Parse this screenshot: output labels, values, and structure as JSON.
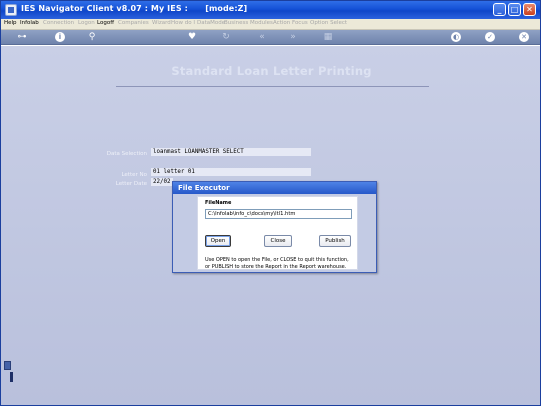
{
  "window": {
    "title": "IES Navigator Client v8.07 : My IES :",
    "mode": "[mode:Z]"
  },
  "menubar": {
    "items": [
      {
        "label": "Help",
        "enabled": true
      },
      {
        "label": "Infolab",
        "enabled": true
      },
      {
        "label": "Connection",
        "enabled": false
      },
      {
        "label": "Logon",
        "enabled": false
      },
      {
        "label": "Logoff",
        "enabled": true
      },
      {
        "label": "Companies",
        "enabled": false
      },
      {
        "label": "Wizard",
        "enabled": false
      },
      {
        "label": "How do I",
        "enabled": false
      },
      {
        "label": "DataMode",
        "enabled": false
      },
      {
        "label": "Business Modules",
        "enabled": false
      },
      {
        "label": "Action Focus",
        "enabled": false
      },
      {
        "label": "Option Select",
        "enabled": false
      }
    ]
  },
  "toolbar": {
    "icons": [
      "key-icon",
      "info-icon",
      "search-icon",
      "heart-icon",
      "refresh-icon",
      "back-icon",
      "forward-icon",
      "grid-icon",
      "globe-icon",
      "check-icon",
      "close-icon"
    ]
  },
  "page": {
    "title": "Standard Loan Letter Printing"
  },
  "fields": {
    "data_selection": {
      "label": "Data Selection",
      "value": "loanmast LOANMASTER SELECT"
    },
    "letter_no": {
      "label": "Letter No",
      "value": "01 letter 01"
    },
    "letter_date": {
      "label": "Letter Date",
      "value": "22/02"
    }
  },
  "dialog": {
    "title": "File Executor",
    "filename_label": "FileName",
    "filename_value": "C:\\Infolab\\info_c\\docs\\my\\ltl1.htm",
    "open_label": "Open",
    "close_label": "Close",
    "publish_label": "Publish",
    "help_text": "Use OPEN to open the File, or CLOSE to quit this function, or PUBLISH to store the Report in the Report warehouse."
  },
  "colors": {
    "titlebar": "#1451d6",
    "content_bg": "#c3c9e2",
    "toolbar": "#7b8eb5"
  }
}
